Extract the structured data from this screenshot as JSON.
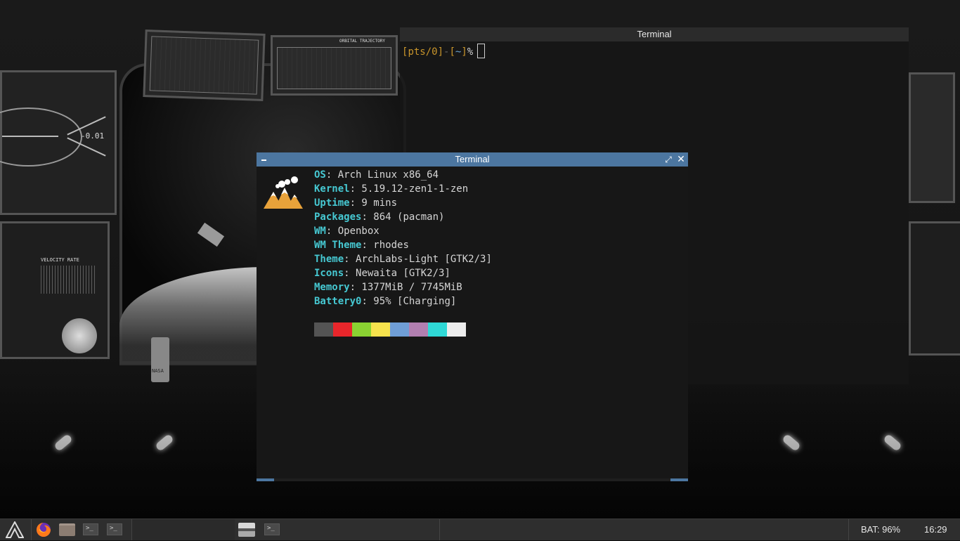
{
  "wallpaper": {
    "hud_readout": "-0.01",
    "nasa_label": "NASA",
    "velocity_label": "VELOCITY RATE",
    "orbital_label": "ORBITAL TRAJECTORY"
  },
  "terminal_back": {
    "title": "Terminal",
    "prompt": {
      "open": "[",
      "tty": "pts/0",
      "close": "]",
      "dash": "-",
      "cwd_open": "[",
      "cwd": "~",
      "cwd_close": "]",
      "symbol": "%"
    }
  },
  "terminal_front": {
    "title": "Terminal",
    "neofetch": [
      {
        "key": "OS",
        "value": ": Arch Linux x86_64"
      },
      {
        "key": "Kernel",
        "value": ": 5.19.12-zen1-1-zen"
      },
      {
        "key": "Uptime",
        "value": ": 9 mins"
      },
      {
        "key": "Packages",
        "value": ": 864 (pacman)"
      },
      {
        "key": "WM",
        "value": ": Openbox"
      },
      {
        "key": "WM Theme",
        "value": ": rhodes"
      },
      {
        "key": "Theme",
        "value": ": ArchLabs-Light [GTK2/3]"
      },
      {
        "key": "Icons",
        "value": ": Newaita [GTK2/3]"
      },
      {
        "key": "Memory",
        "value": ": 1377MiB / 7745MiB"
      },
      {
        "key": "Battery0",
        "value": ": 95% [Charging]"
      }
    ],
    "palette": [
      "#545454",
      "#e8262b",
      "#8ad232",
      "#f6e24d",
      "#6f9ed6",
      "#b27fb0",
      "#2fd8d6",
      "#ececec"
    ],
    "colors": {
      "title_bar": "#4c76a0",
      "key": "#46c8d2"
    }
  },
  "taskbar": {
    "battery": "BAT: 96%",
    "clock": "16:29",
    "icons": [
      "archlabs-logo-icon",
      "firefox-icon",
      "file-manager-icon",
      "terminal-icon",
      "terminal-icon",
      "rhodes-app-icon",
      "terminal-icon"
    ],
    "term_glyph": ">_"
  }
}
